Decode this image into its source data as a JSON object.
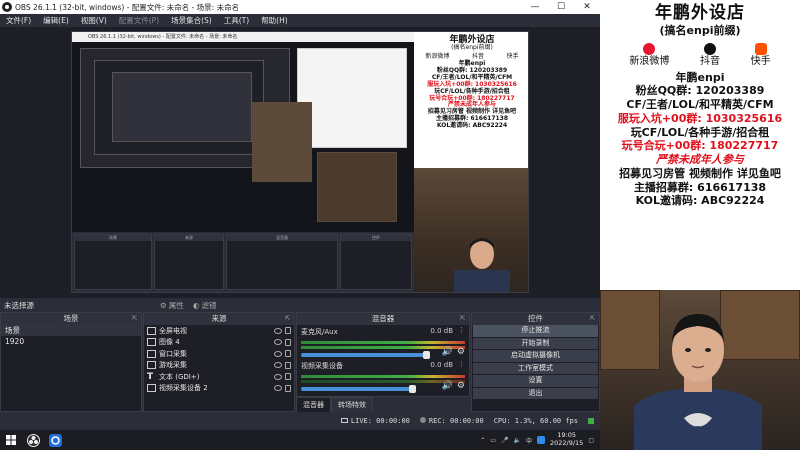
{
  "window": {
    "title": "OBS 26.1.1 (32-bit, windows) - 配置文件: 未命名 - 场景: 未命名",
    "controls": [
      "—",
      "☐",
      "✕"
    ]
  },
  "menu": [
    {
      "label": "文件(F)"
    },
    {
      "label": "编辑(E)"
    },
    {
      "label": "视图(V)"
    },
    {
      "label": "配置文件(P)"
    },
    {
      "label": "场景集合(S)"
    },
    {
      "label": "工具(T)"
    },
    {
      "label": "帮助(H)"
    }
  ],
  "inner_capture": {
    "title_bar": "OBS 26.1.1 (32-bit, windows) - 配置文件: 未命名 - 场景: 未命名",
    "poster": {
      "title": "年鹏外设店",
      "subtitle": "(搞名enpi前缀)",
      "social": [
        "新浪微博",
        "抖音",
        "快手"
      ],
      "name": "年鹏enpi",
      "lines": [
        {
          "text": "粉丝QQ群: 120203389",
          "red": false
        },
        {
          "text": "CF/王者/LOL/和平精英/CFM",
          "red": false
        },
        {
          "text": "服玩入坑+00群: 1030325616",
          "red": true
        },
        {
          "text": "玩CF/LOL/各种手游/招合租",
          "red": false
        },
        {
          "text": "玩号合玩+00群: 180227717",
          "red": true
        },
        {
          "text": "严禁未成年人参与",
          "red": true
        },
        {
          "text": "招募见习房管 视频制作 详见鱼吧",
          "red": false
        },
        {
          "text": "主播招募群: 616617138",
          "red": false
        },
        {
          "text": "KOL邀请码: ABC92224",
          "red": false
        }
      ]
    }
  },
  "dock": {
    "no_source": "未选择源",
    "properties": "属性",
    "filters": "滤镜"
  },
  "scenes": {
    "title": "场景",
    "items": [
      "场景",
      "1920"
    ]
  },
  "sources": {
    "title": "来源",
    "items": [
      {
        "icon": "game-capture-icon",
        "label": "全屏电视"
      },
      {
        "icon": "image-icon",
        "label": "图像 4"
      },
      {
        "icon": "window-capture-icon",
        "label": "窗口采集"
      },
      {
        "icon": "game-capture-icon",
        "label": "游戏采集"
      },
      {
        "icon": "text-icon",
        "label": "文本 (GDI+)"
      },
      {
        "icon": "video-capture-icon",
        "label": "视频采集设备 2"
      }
    ]
  },
  "mixer": {
    "title": "混音器",
    "channels": [
      {
        "name": "麦克风/Aux",
        "db": "0.0 dB",
        "level_pct": 70
      },
      {
        "name": "视频采集设备",
        "db": "0.0 dB",
        "level_pct": 62
      }
    ],
    "tabs": [
      "混音器",
      "转场特效"
    ]
  },
  "controls": {
    "title": "控件",
    "buttons": [
      "停止推流",
      "开始录制",
      "启动虚拟摄像机",
      "工作室模式",
      "设置",
      "退出"
    ]
  },
  "status": {
    "live": "LIVE: 00:00:00",
    "rec": "REC: 00:00:00",
    "cpu": "CPU: 1.3%, 60.00 fps"
  },
  "taskbar": {
    "time": "19:05",
    "date": "2022/9/15",
    "lang": "中"
  },
  "colors": {
    "panel_bg": "#1e1f26",
    "window_bg": "#2b2e38",
    "accent_red": "#e0101c",
    "meter_green": "#3fae44",
    "fader_blue": "#4a90d9"
  }
}
